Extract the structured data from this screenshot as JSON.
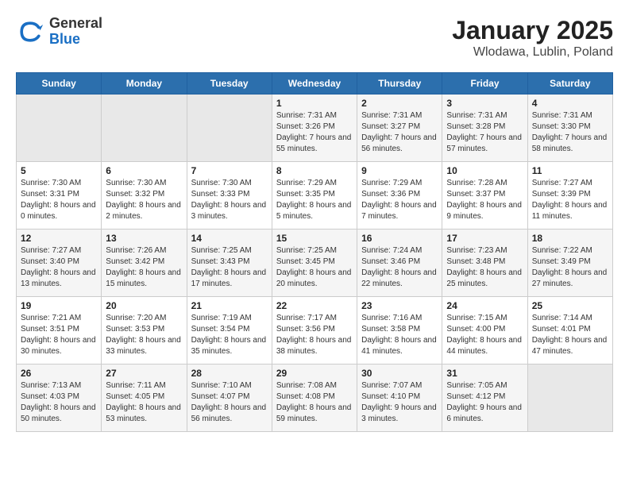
{
  "header": {
    "logo_general": "General",
    "logo_blue": "Blue",
    "title": "January 2025",
    "subtitle": "Wlodawa, Lublin, Poland"
  },
  "days_of_week": [
    "Sunday",
    "Monday",
    "Tuesday",
    "Wednesday",
    "Thursday",
    "Friday",
    "Saturday"
  ],
  "weeks": [
    [
      {
        "day": "",
        "empty": true
      },
      {
        "day": "",
        "empty": true
      },
      {
        "day": "",
        "empty": true
      },
      {
        "day": "1",
        "sunrise": "7:31 AM",
        "sunset": "3:26 PM",
        "daylight": "7 hours and 55 minutes."
      },
      {
        "day": "2",
        "sunrise": "7:31 AM",
        "sunset": "3:27 PM",
        "daylight": "7 hours and 56 minutes."
      },
      {
        "day": "3",
        "sunrise": "7:31 AM",
        "sunset": "3:28 PM",
        "daylight": "7 hours and 57 minutes."
      },
      {
        "day": "4",
        "sunrise": "7:31 AM",
        "sunset": "3:30 PM",
        "daylight": "7 hours and 58 minutes."
      }
    ],
    [
      {
        "day": "5",
        "sunrise": "7:30 AM",
        "sunset": "3:31 PM",
        "daylight": "8 hours and 0 minutes."
      },
      {
        "day": "6",
        "sunrise": "7:30 AM",
        "sunset": "3:32 PM",
        "daylight": "8 hours and 2 minutes."
      },
      {
        "day": "7",
        "sunrise": "7:30 AM",
        "sunset": "3:33 PM",
        "daylight": "8 hours and 3 minutes."
      },
      {
        "day": "8",
        "sunrise": "7:29 AM",
        "sunset": "3:35 PM",
        "daylight": "8 hours and 5 minutes."
      },
      {
        "day": "9",
        "sunrise": "7:29 AM",
        "sunset": "3:36 PM",
        "daylight": "8 hours and 7 minutes."
      },
      {
        "day": "10",
        "sunrise": "7:28 AM",
        "sunset": "3:37 PM",
        "daylight": "8 hours and 9 minutes."
      },
      {
        "day": "11",
        "sunrise": "7:27 AM",
        "sunset": "3:39 PM",
        "daylight": "8 hours and 11 minutes."
      }
    ],
    [
      {
        "day": "12",
        "sunrise": "7:27 AM",
        "sunset": "3:40 PM",
        "daylight": "8 hours and 13 minutes."
      },
      {
        "day": "13",
        "sunrise": "7:26 AM",
        "sunset": "3:42 PM",
        "daylight": "8 hours and 15 minutes."
      },
      {
        "day": "14",
        "sunrise": "7:25 AM",
        "sunset": "3:43 PM",
        "daylight": "8 hours and 17 minutes."
      },
      {
        "day": "15",
        "sunrise": "7:25 AM",
        "sunset": "3:45 PM",
        "daylight": "8 hours and 20 minutes."
      },
      {
        "day": "16",
        "sunrise": "7:24 AM",
        "sunset": "3:46 PM",
        "daylight": "8 hours and 22 minutes."
      },
      {
        "day": "17",
        "sunrise": "7:23 AM",
        "sunset": "3:48 PM",
        "daylight": "8 hours and 25 minutes."
      },
      {
        "day": "18",
        "sunrise": "7:22 AM",
        "sunset": "3:49 PM",
        "daylight": "8 hours and 27 minutes."
      }
    ],
    [
      {
        "day": "19",
        "sunrise": "7:21 AM",
        "sunset": "3:51 PM",
        "daylight": "8 hours and 30 minutes."
      },
      {
        "day": "20",
        "sunrise": "7:20 AM",
        "sunset": "3:53 PM",
        "daylight": "8 hours and 33 minutes."
      },
      {
        "day": "21",
        "sunrise": "7:19 AM",
        "sunset": "3:54 PM",
        "daylight": "8 hours and 35 minutes."
      },
      {
        "day": "22",
        "sunrise": "7:17 AM",
        "sunset": "3:56 PM",
        "daylight": "8 hours and 38 minutes."
      },
      {
        "day": "23",
        "sunrise": "7:16 AM",
        "sunset": "3:58 PM",
        "daylight": "8 hours and 41 minutes."
      },
      {
        "day": "24",
        "sunrise": "7:15 AM",
        "sunset": "4:00 PM",
        "daylight": "8 hours and 44 minutes."
      },
      {
        "day": "25",
        "sunrise": "7:14 AM",
        "sunset": "4:01 PM",
        "daylight": "8 hours and 47 minutes."
      }
    ],
    [
      {
        "day": "26",
        "sunrise": "7:13 AM",
        "sunset": "4:03 PM",
        "daylight": "8 hours and 50 minutes."
      },
      {
        "day": "27",
        "sunrise": "7:11 AM",
        "sunset": "4:05 PM",
        "daylight": "8 hours and 53 minutes."
      },
      {
        "day": "28",
        "sunrise": "7:10 AM",
        "sunset": "4:07 PM",
        "daylight": "8 hours and 56 minutes."
      },
      {
        "day": "29",
        "sunrise": "7:08 AM",
        "sunset": "4:08 PM",
        "daylight": "8 hours and 59 minutes."
      },
      {
        "day": "30",
        "sunrise": "7:07 AM",
        "sunset": "4:10 PM",
        "daylight": "9 hours and 3 minutes."
      },
      {
        "day": "31",
        "sunrise": "7:05 AM",
        "sunset": "4:12 PM",
        "daylight": "9 hours and 6 minutes."
      },
      {
        "day": "",
        "empty": true
      }
    ]
  ]
}
